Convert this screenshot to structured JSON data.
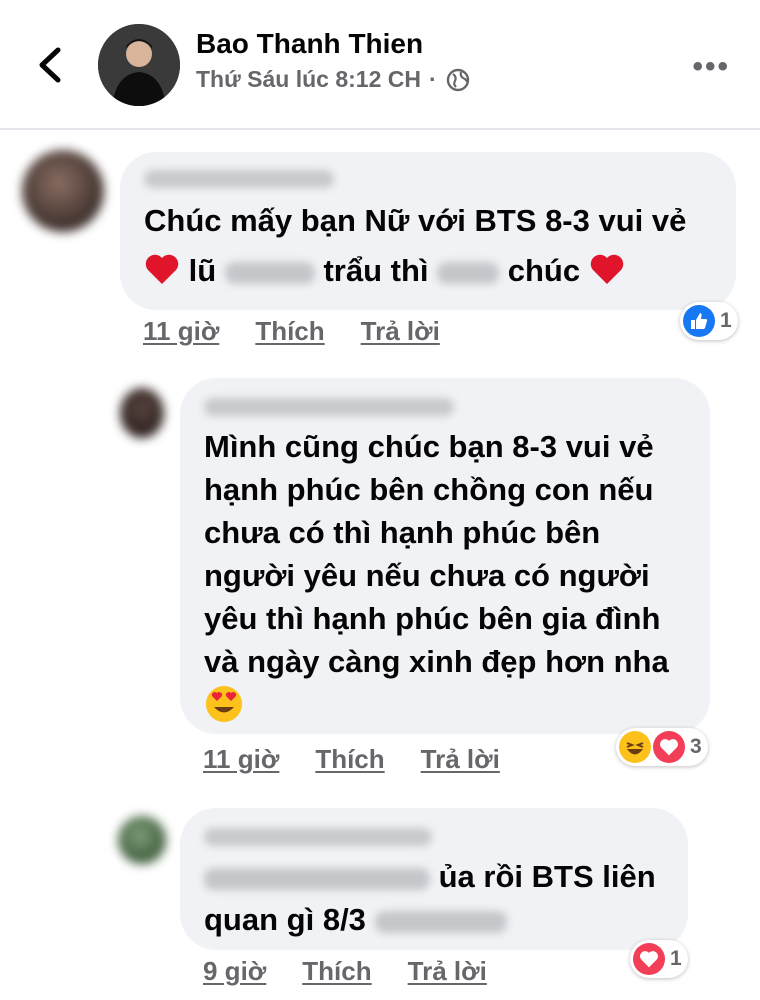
{
  "post": {
    "author": "Bao Thanh Thien",
    "timestamp": "Thứ Sáu lúc 8:12 CH",
    "separator": "·"
  },
  "comments": [
    {
      "line1": "Chúc mấy bạn Nữ với BTS 8-3 vui vẻ",
      "line2_a": "lũ",
      "line2_b": "trẩu thì",
      "line2_c": "chúc",
      "time": "11 giờ",
      "like": "Thích",
      "reply": "Trả lời",
      "reaction_count": "1",
      "reactions": [
        "like-icon"
      ]
    },
    {
      "lines": [
        "Mình cũng chúc bạn 8-3 vui vẻ",
        "hạnh phúc bên chồng con nếu",
        "chưa có thì hạnh phúc bên",
        "người yêu nếu chưa có người",
        "yêu thì hạnh phúc bên gia đình",
        "và ngày càng xinh đẹp hơn nha"
      ],
      "emoji": "😍",
      "time": "11 giờ",
      "like": "Thích",
      "reply": "Trả lời",
      "reaction_count": "3",
      "reactions": [
        "haha-icon",
        "love-icon"
      ]
    },
    {
      "line1": "ủa rồi BTS liên",
      "line2": "quan gì 8/3",
      "time": "9 giờ",
      "like": "Thích",
      "reply": "Trả lời",
      "reaction_count": "1",
      "reactions": [
        "love-icon"
      ]
    }
  ],
  "colors": {
    "bubble": "#f0f2f5",
    "meta": "#65676b",
    "like_blue": "#1877f2",
    "love_red": "#f33e58"
  }
}
